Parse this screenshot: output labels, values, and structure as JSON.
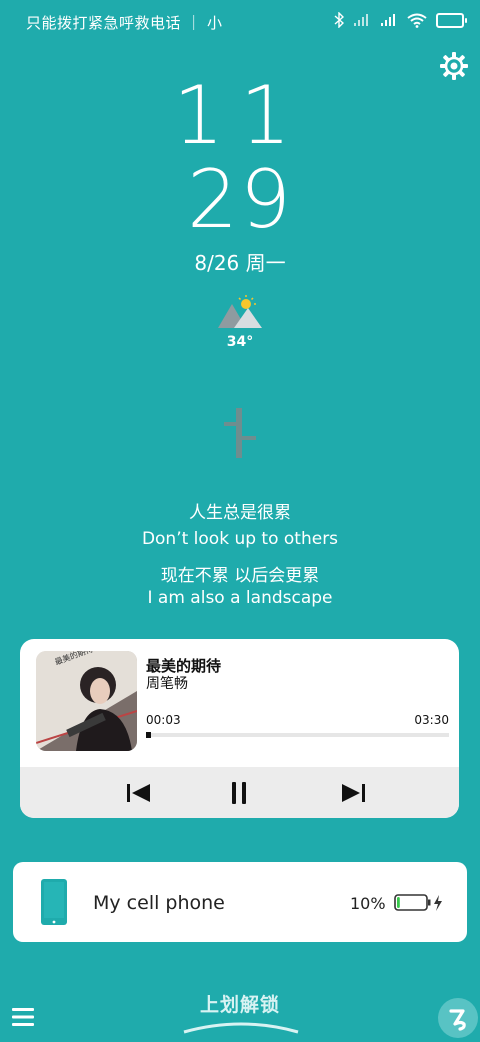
{
  "status_bar": {
    "carrier_text": "只能拨打紧急呼救电话 ｜ 小",
    "icons": [
      "bluetooth-icon",
      "no-signal-icon",
      "signal-icon",
      "wifi-icon",
      "battery-icon"
    ]
  },
  "clock": {
    "hour": "11",
    "minute": "29"
  },
  "date": "8/26 周一",
  "weather": {
    "icon": "sunny-mountains-icon",
    "temperature": "34°"
  },
  "quote": {
    "line1": "人生总是很累",
    "line2": "Don’t look up to others",
    "line3": "现在不累 以后会更累",
    "line4": "I am also a landscape"
  },
  "music": {
    "title": "最美的期待",
    "artist": "周笔畅",
    "current_time": "00:03",
    "total_time": "03:30",
    "progress": 0.015,
    "album_text": "最美的期待"
  },
  "device": {
    "name": "My cell phone",
    "battery_percent": "10%",
    "battery_level": 0.1
  },
  "unlock_hint": "上划解锁",
  "colors": {
    "background": "#1fabac",
    "card": "#ffffff",
    "controls_bg": "#ececec",
    "battery_low": "#37c84a"
  }
}
